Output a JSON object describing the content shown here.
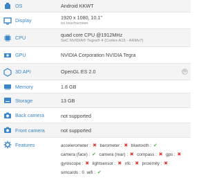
{
  "colors": {
    "label": "#3a86c8",
    "yes": "#4caf50",
    "no": "#e0382f"
  },
  "rows": [
    {
      "id": "os",
      "icon": "os-icon",
      "label": "OS",
      "value": "Android KKWT",
      "sub": ""
    },
    {
      "id": "display",
      "icon": "display-icon",
      "label": "Display",
      "value": "1920 x 1080, 10.1\"",
      "sub": "no touchscreen"
    },
    {
      "id": "cpu",
      "icon": "cpu-icon",
      "label": "CPU",
      "value": "quad core CPU @1912MHz",
      "sub": "SoC NVIDIA® Tegra® 4 (Cortex A15 - ARMv7)"
    },
    {
      "id": "gpu",
      "icon": "gpu-icon",
      "label": "GPU",
      "value": "NVIDIA Corporation NVIDIA Tegra",
      "sub": ""
    },
    {
      "id": "api",
      "icon": "3d-api-icon",
      "label": "3D API",
      "value": "OpenGL ES 2.0",
      "sub": ""
    },
    {
      "id": "memory",
      "icon": "memory-icon",
      "label": "Memory",
      "value": "1.8 GB",
      "sub": ""
    },
    {
      "id": "storage",
      "icon": "storage-icon",
      "label": "Storage",
      "value": "13 GB",
      "sub": ""
    },
    {
      "id": "back_camera",
      "icon": "camera-icon",
      "label": "Back camera",
      "value": "not supported",
      "sub": ""
    },
    {
      "id": "front_camera",
      "icon": "camera-icon",
      "label": "Front camera",
      "value": "not supported",
      "sub": ""
    }
  ],
  "features": {
    "label": "Features",
    "lines": [
      [
        {
          "name": "accelerometer",
          "ok": false
        },
        {
          "name": "barometer",
          "ok": false
        },
        {
          "name": "bluetooth",
          "ok": true
        }
      ],
      [
        {
          "name": "camera (face)",
          "ok": true
        },
        {
          "name": "camera (rear)",
          "ok": false
        },
        {
          "name": "compass",
          "ok": false
        },
        {
          "name": "gps",
          "ok": false
        }
      ],
      [
        {
          "name": "gyroscope",
          "ok": false
        },
        {
          "name": "lightsensor",
          "ok": false
        },
        {
          "name": "nfc",
          "ok": false
        },
        {
          "name": "proximity",
          "ok": false
        }
      ],
      [
        {
          "name": "simcards",
          "count": "0"
        },
        {
          "name": "wifi",
          "ok": true
        }
      ]
    ]
  }
}
